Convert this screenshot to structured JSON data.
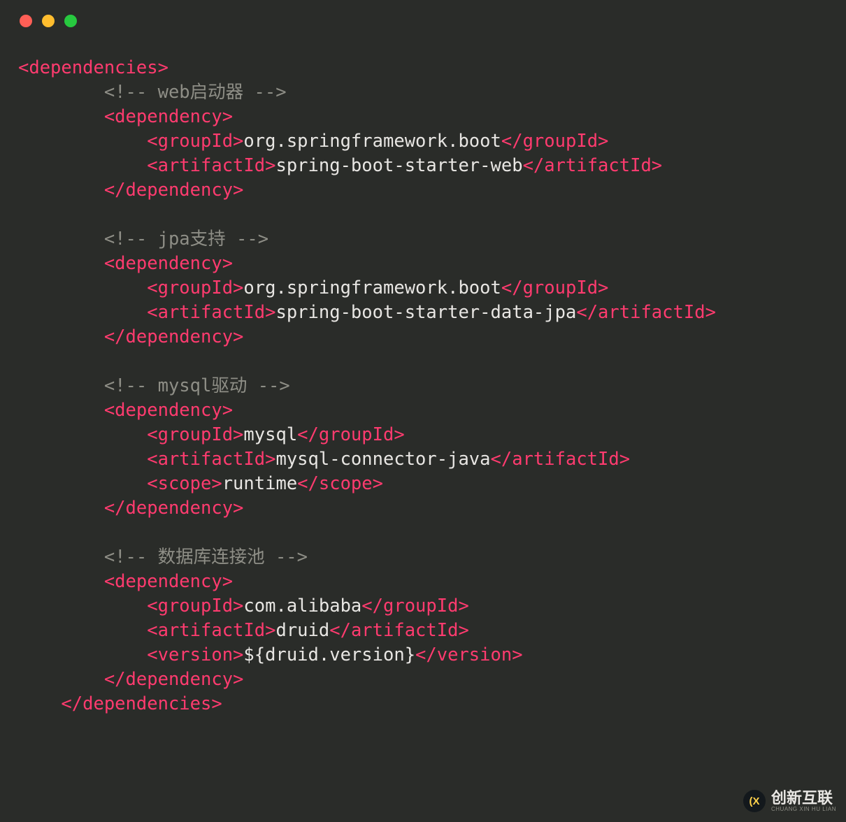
{
  "colors": {
    "background": "#2a2c29",
    "tag": "#ff3b6f",
    "comment": "#8e8e86",
    "text": "#e8e6e3"
  },
  "window_controls": {
    "close": "red",
    "minimize": "yellow",
    "zoom": "green"
  },
  "code": {
    "line1_open": "<dependencies>",
    "comment_web": "<!-- web启动器 -->",
    "dep_open": "<dependency>",
    "dep_close": "</dependency>",
    "groupId_open": "<groupId>",
    "groupId_close": "</groupId>",
    "artifactId_open": "<artifactId>",
    "artifactId_close": "</artifactId>",
    "scope_open": "<scope>",
    "scope_close": "</scope>",
    "version_open": "<version>",
    "version_close": "</version>",
    "dependencies_close": "</dependencies>",
    "dep1_group": "org.springframework.boot",
    "dep1_artifact": "spring-boot-starter-web",
    "comment_jpa": "<!-- jpa支持 -->",
    "dep2_group": "org.springframework.boot",
    "dep2_artifact": "spring-boot-starter-data-jpa",
    "comment_mysql": "<!-- mysql驱动 -->",
    "dep3_group": "mysql",
    "dep3_artifact": "mysql-connector-java",
    "dep3_scope": "runtime",
    "comment_pool": "<!-- 数据库连接池 -->",
    "dep4_group": "com.alibaba",
    "dep4_artifact": "druid",
    "dep4_version": "${druid.version}"
  },
  "logo": {
    "badge": "(X",
    "name": "创新互联",
    "sub": "CHUANG XIN HU LIAN"
  }
}
